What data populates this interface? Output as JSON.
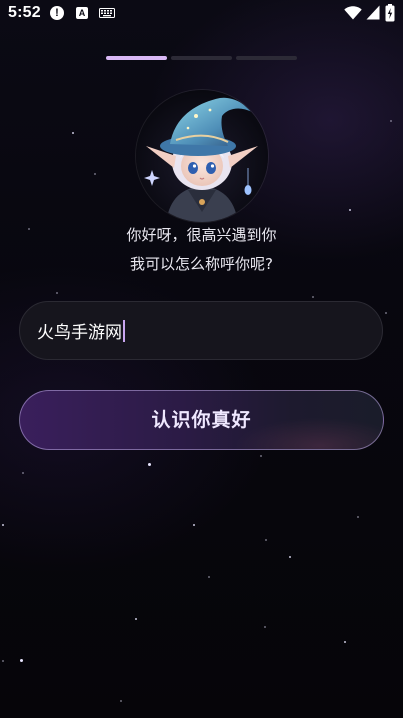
{
  "status_bar": {
    "time": "5:52",
    "alert_glyph": "!",
    "a_glyph": "A",
    "icons": [
      "alert-icon",
      "a-notification-icon",
      "keyboard-icon",
      "wifi-icon",
      "signal-icon",
      "battery-icon"
    ]
  },
  "progress": {
    "total_steps": 3,
    "current_step": 1
  },
  "avatar": {
    "description_icon": "elf-wizard-avatar"
  },
  "greeting": {
    "line1": "你好呀，很高兴遇到你",
    "line2": "我可以怎么称呼你呢?"
  },
  "name_field": {
    "value": "火鸟手游网"
  },
  "primary_button": {
    "label": "认识你真好"
  },
  "colors": {
    "background": "#07060c",
    "progress_active": "#d9b8f5",
    "progress_inactive": "#2c2a36",
    "input_bg": "#16151d",
    "button_gradient_start": "#3a1f5c",
    "button_gradient_end": "#1a1c2a",
    "caret": "#c9a6f0"
  }
}
